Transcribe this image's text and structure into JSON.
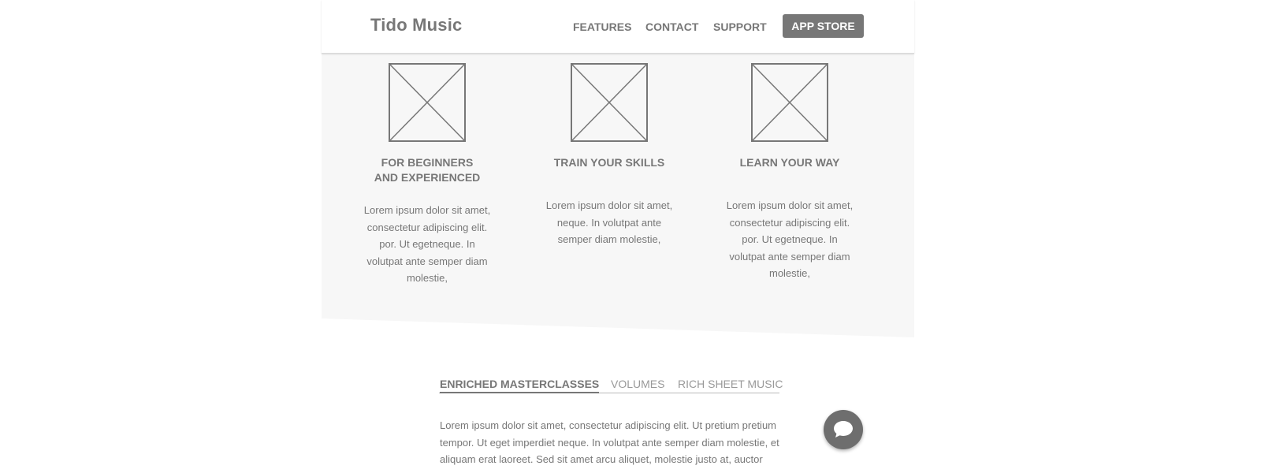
{
  "header": {
    "logo": "Tido Music",
    "nav": [
      "FEATURES",
      "CONTACT",
      "SUPPORT"
    ],
    "cta": "APP STORE"
  },
  "features": [
    {
      "title_lines": [
        "FOR BEGINNERS",
        "AND EXPERIENCED"
      ],
      "text_lines": [
        "Lorem ipsum dolor sit amet,",
        "consectetur adipiscing elit.",
        "por. Ut egetneque. In",
        "volutpat ante semper diam",
        "molestie,"
      ]
    },
    {
      "title_lines": [
        "TRAIN YOUR SKILLS"
      ],
      "text_lines": [
        "Lorem ipsum dolor sit amet,",
        "neque. In volutpat ante",
        "semper diam molestie,"
      ]
    },
    {
      "title_lines": [
        "LEARN YOUR WAY"
      ],
      "text_lines": [
        "Lorem ipsum dolor sit amet,",
        "consectetur adipiscing elit.",
        "por. Ut egetneque. In",
        "volutpat ante semper diam",
        "molestie,"
      ]
    }
  ],
  "tabs": [
    "ENRICHED MASTERCLASSES",
    "VOLUMES",
    "RICH SHEET MUSIC"
  ],
  "active_tab": "ENRICHED MASTERCLASSES",
  "tab_content_lines": [
    "Lorem ipsum dolor sit amet, consectetur adipiscing elit. Ut pretium pretium",
    "tempor. Ut eget imperdiet neque. In volutpat ante semper diam molestie, et",
    "aliquam erat laoreet. Sed sit amet arcu aliquet, molestie justo at, auctor"
  ],
  "chat_button": {
    "icon": "chat-bubble-icon"
  },
  "colors": {
    "primary": "#777777",
    "section_bg": "#f7f7f7",
    "muted_tab": "#999999"
  }
}
